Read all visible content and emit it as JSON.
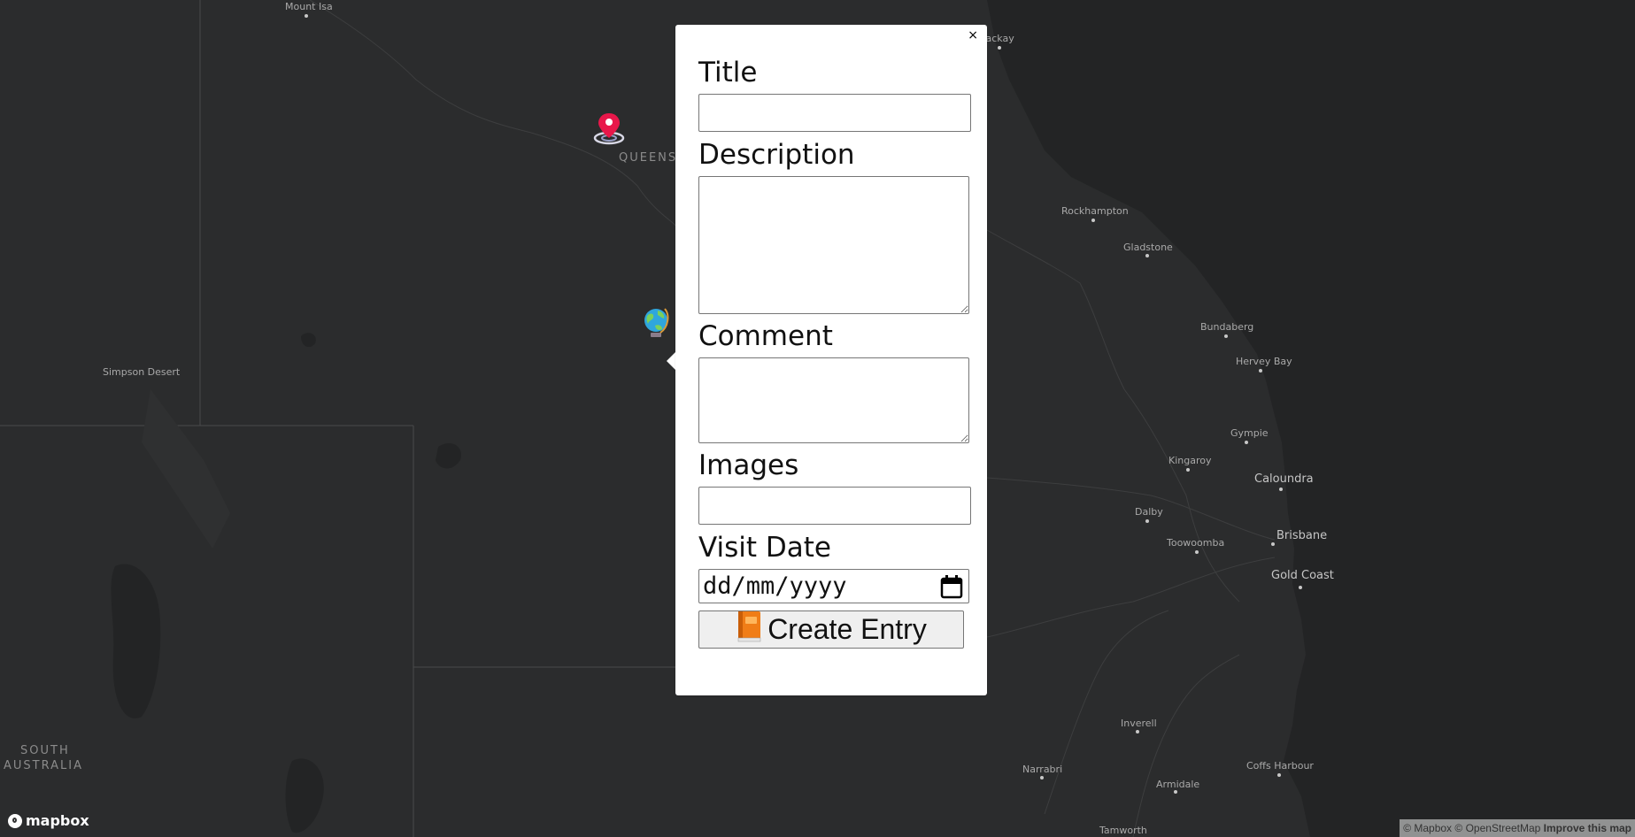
{
  "map": {
    "places": [
      {
        "key": "mount_isa",
        "label": "Mount Isa"
      },
      {
        "key": "mackay",
        "label": "Mackay"
      },
      {
        "key": "queensland",
        "label": "QUEENS"
      },
      {
        "key": "rockhampton",
        "label": "Rockhampton"
      },
      {
        "key": "gladstone",
        "label": "Gladstone"
      },
      {
        "key": "simpson_desert",
        "label": "Simpson Desert"
      },
      {
        "key": "bundaberg",
        "label": "Bundaberg"
      },
      {
        "key": "hervey_bay",
        "label": "Hervey Bay"
      },
      {
        "key": "gympie",
        "label": "Gympie"
      },
      {
        "key": "kingaroy",
        "label": "Kingaroy"
      },
      {
        "key": "caloundra",
        "label": "Caloundra"
      },
      {
        "key": "dalby",
        "label": "Dalby"
      },
      {
        "key": "brisbane",
        "label": "Brisbane"
      },
      {
        "key": "toowoomba",
        "label": "Toowoomba"
      },
      {
        "key": "gold_coast",
        "label": "Gold Coast"
      },
      {
        "key": "south_australia_1",
        "label": "SOUTH"
      },
      {
        "key": "south_australia_2",
        "label": "AUSTRALIA"
      },
      {
        "key": "inverell",
        "label": "Inverell"
      },
      {
        "key": "narrabri",
        "label": "Narrabri"
      },
      {
        "key": "armidale",
        "label": "Armidale"
      },
      {
        "key": "coffs_harbour",
        "label": "Coffs Harbour"
      },
      {
        "key": "tamworth",
        "label": "Tamworth"
      }
    ],
    "markers": [
      {
        "name": "pin-marker-icon"
      },
      {
        "name": "globe-marker-icon"
      }
    ],
    "logo_text": "mapbox",
    "attribution": {
      "mapbox": "© Mapbox",
      "osm": "© OpenStreetMap",
      "improve": "Improve this map"
    }
  },
  "popup": {
    "close_label": "×",
    "form": {
      "title_label": "Title",
      "title_value": "",
      "description_label": "Description",
      "description_value": "",
      "comment_label": "Comment",
      "comment_value": "",
      "images_label": "Images",
      "images_value": "",
      "visit_date_label": "Visit Date",
      "visit_date_placeholder": "dd/mm/yyyy",
      "submit_label": "Create Entry",
      "submit_icon": "orange-book-icon"
    }
  },
  "colors": {
    "map_background": "#2b2c2d",
    "popup_background": "#ffffff",
    "pin": "#e8174a"
  }
}
